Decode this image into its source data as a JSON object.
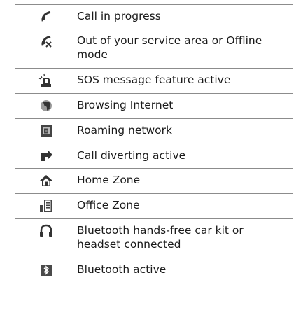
{
  "rows": [
    {
      "icon": "call-in-progress-icon",
      "text": "Call in progress"
    },
    {
      "icon": "no-service-icon",
      "text": "Out of your service area or Offline mode"
    },
    {
      "icon": "sos-icon",
      "text": "SOS message feature active"
    },
    {
      "icon": "browsing-internet-icon",
      "text": "Browsing Internet"
    },
    {
      "icon": "roaming-icon",
      "text": "Roaming network"
    },
    {
      "icon": "call-divert-icon",
      "text": "Call diverting active"
    },
    {
      "icon": "home-zone-icon",
      "text": "Home Zone"
    },
    {
      "icon": "office-zone-icon",
      "text": "Office Zone"
    },
    {
      "icon": "headset-icon",
      "text": "Bluetooth hands-free car kit or headset connected"
    },
    {
      "icon": "bluetooth-icon",
      "text": "Bluetooth active"
    }
  ]
}
